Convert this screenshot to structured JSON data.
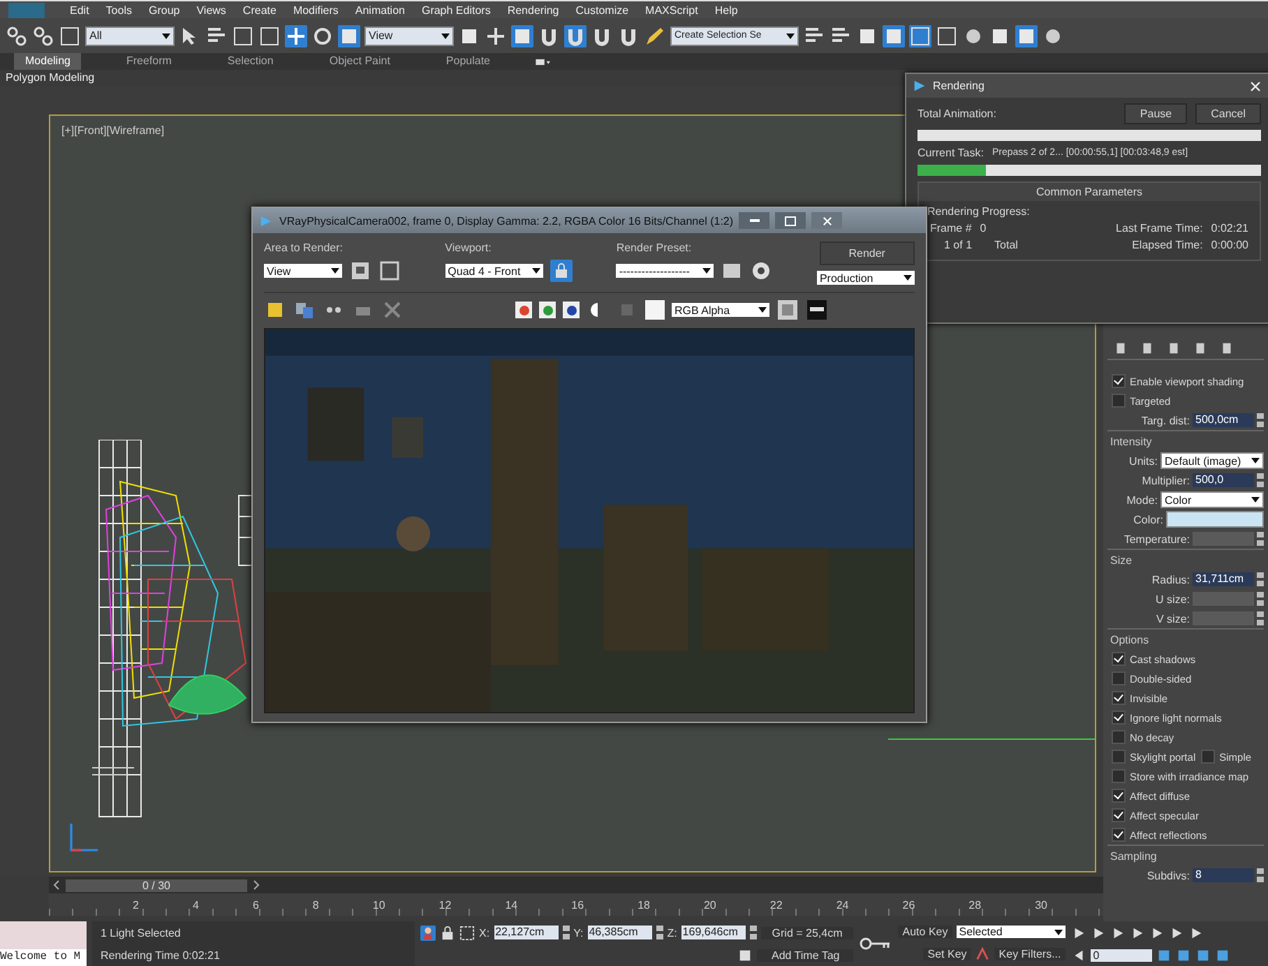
{
  "menu_bar": [
    "Edit",
    "Tools",
    "Group",
    "Views",
    "Create",
    "Modifiers",
    "Animation",
    "Graph Editors",
    "Rendering",
    "Customize",
    "MAXScript",
    "Help"
  ],
  "toolbar": {
    "selection_filter": "All",
    "reference_coordinate_system": "View",
    "named_selection_set": "Create Selection Se"
  },
  "ribbon": {
    "tabs": [
      {
        "label": "Modeling",
        "selected": true
      },
      {
        "label": "Freeform",
        "selected": false
      },
      {
        "label": "Selection",
        "selected": false
      },
      {
        "label": "Object Paint",
        "selected": false
      },
      {
        "label": "Populate",
        "selected": false
      }
    ],
    "panel_label": "Polygon Modeling"
  },
  "viewport": {
    "label": "[+][Front][Wireframe]"
  },
  "frame_window": {
    "title": "VRayPhysicalCamera002, frame 0, Display Gamma: 2.2, RGBA Color 16 Bits/Channel (1:2)",
    "area_label": "Area to Render:",
    "area_value": "View",
    "viewport_label": "Viewport:",
    "viewport_value": "Quad 4 - Front",
    "preset_label": "Render Preset:",
    "preset_value": "-------------------",
    "render_button": "Render",
    "mode_value": "Production",
    "display_channel": "RGB Alpha",
    "channels": [
      {
        "color": "#d9452f",
        "on": true
      },
      {
        "color": "#2f9a3c",
        "on": true
      },
      {
        "color": "#2346a8",
        "on": true
      }
    ]
  },
  "rendering_dialog": {
    "title": "Rendering",
    "total_label": "Total Animation:",
    "total_progress": {
      "level": 0
    },
    "buttons": [
      "Pause",
      "Cancel"
    ],
    "task_label": "Current Task:",
    "task_text": "Prepass 2 of 2... [00:00:55,1] [00:03:48,9 est]",
    "task_progress": {
      "level": 0.2
    },
    "section_title": "Common Parameters",
    "progress_label": "Rendering Progress:",
    "frame_label": "Frame #",
    "frame_value": "0",
    "count_text": "1 of 1",
    "total_text": "Total",
    "last_frame_label": "Last Frame Time:",
    "last_frame_value": "0:02:21",
    "elapsed_label": "Elapsed Time:",
    "elapsed_value": "0:00:00"
  },
  "command_panel": [
    {
      "kind": "checkbox",
      "label": "Enable viewport shading",
      "checked": true
    },
    {
      "kind": "checkbox",
      "label": "Targeted",
      "checked": false
    },
    {
      "kind": "field",
      "label": "Targ. dist:",
      "value": "500,0cm",
      "disabled": false
    },
    {
      "kind": "section",
      "label": "Intensity"
    },
    {
      "kind": "dropdown",
      "label": "Units:",
      "value": "Default (image)"
    },
    {
      "kind": "field",
      "label": "Multiplier:",
      "value": "500,0",
      "disabled": false
    },
    {
      "kind": "dropdown",
      "label": "Mode:",
      "value": "Color"
    },
    {
      "kind": "color",
      "label": "Color:",
      "color": "#c9e4f2"
    },
    {
      "kind": "field",
      "label": "Temperature:",
      "disabled": true
    },
    {
      "kind": "section",
      "label": "Size"
    },
    {
      "kind": "field",
      "label": "Radius:",
      "value": "31,711cm",
      "disabled": false
    },
    {
      "kind": "field",
      "label": "U size:",
      "disabled": true
    },
    {
      "kind": "field",
      "label": "V size:",
      "disabled": true
    },
    {
      "kind": "section",
      "label": "Options"
    },
    {
      "kind": "checkbox",
      "label": "Cast shadows",
      "checked": true
    },
    {
      "kind": "checkbox",
      "label": "Double-sided",
      "checked": false
    },
    {
      "kind": "checkbox",
      "label": "Invisible",
      "checked": true
    },
    {
      "kind": "checkbox",
      "label": "Ignore light normals",
      "checked": true
    },
    {
      "kind": "checkbox",
      "label": "No decay",
      "checked": false
    },
    {
      "kind": "checkbox",
      "label": "Skylight portal",
      "checked": false,
      "extra": {
        "label": "Simple",
        "checked": false
      }
    },
    {
      "kind": "checkbox",
      "label": "Store with irradiance map",
      "checked": false
    },
    {
      "kind": "checkbox",
      "label": "Affect diffuse",
      "checked": true
    },
    {
      "kind": "checkbox",
      "label": "Affect specular",
      "checked": true
    },
    {
      "kind": "checkbox",
      "label": "Affect reflections",
      "checked": true
    },
    {
      "kind": "section",
      "label": "Sampling"
    },
    {
      "kind": "field",
      "label": "Subdivs:",
      "value": "8",
      "disabled": false
    }
  ],
  "time_slider": {
    "position": "0 / 30",
    "ticks": [
      "2",
      "4",
      "6",
      "8",
      "10",
      "12",
      "14",
      "16",
      "18",
      "20",
      "22",
      "24",
      "26",
      "28",
      "30"
    ]
  },
  "status_bar": {
    "prompt": "Welcome to M",
    "selection": "1 Light Selected",
    "render_time": "Rendering Time 0:02:21",
    "coordinates": [
      {
        "label": "X:",
        "value": "22,127cm"
      },
      {
        "label": "Y:",
        "value": "46,385cm"
      },
      {
        "label": "Z:",
        "value": "169,646cm"
      }
    ],
    "grid": "Grid = 25,4cm",
    "add_time_tag": "Add Time Tag",
    "auto_key": "Auto Key",
    "key_mode": "Selected",
    "set_key": "Set Key",
    "key_filters": "Key Filters...",
    "frame": "0"
  }
}
